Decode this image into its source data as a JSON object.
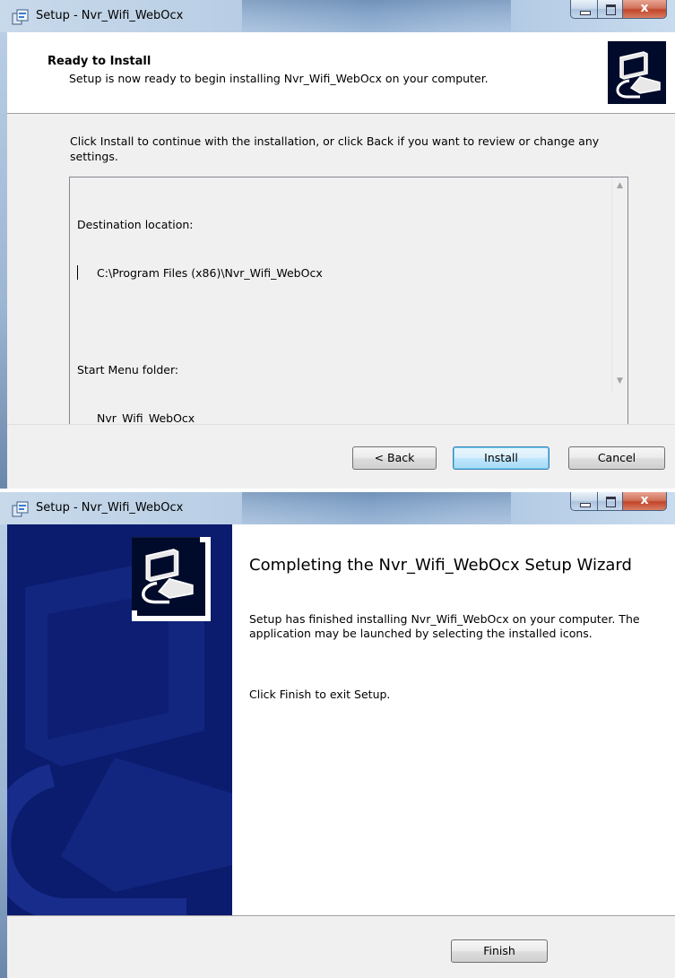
{
  "window1": {
    "title": "Setup - Nvr_Wifi_WebOcx",
    "header": {
      "title": "Ready to Install",
      "subtitle": "Setup is now ready to begin installing Nvr_Wifi_WebOcx on your computer."
    },
    "instructions": "Click Install to continue with the installation, or click Back if you want to review or change any settings.",
    "memo": {
      "destination_label": "Destination location:",
      "destination_value": "C:\\Program Files (x86)\\Nvr_Wifi_WebOcx",
      "start_menu_label": "Start Menu folder:",
      "start_menu_value": "Nvr_Wifi_WebOcx"
    },
    "buttons": {
      "back": "< Back",
      "install": "Install",
      "cancel": "Cancel"
    }
  },
  "window2": {
    "title": "Setup - Nvr_Wifi_WebOcx",
    "heading": "Completing the Nvr_Wifi_WebOcx Setup Wizard",
    "body": "Setup has finished installing Nvr_Wifi_WebOcx on your computer. The application may be launched by selecting the installed icons.",
    "exit_text": "Click Finish to exit Setup.",
    "buttons": {
      "finish": "Finish"
    }
  },
  "caption_buttons": {
    "close_glyph": "x"
  },
  "icons": [
    "setup-app-icon",
    "minimize-icon",
    "maximize-icon",
    "close-icon",
    "computer-setup-logo-icon",
    "scroll-up-icon",
    "scroll-down-icon",
    "scroll-left-icon",
    "scroll-right-icon"
  ],
  "colors": {
    "banner_blue": "#0b1b6e",
    "dialog_gray": "#f0f0f0",
    "default_button_border": "#3c7fb1"
  }
}
